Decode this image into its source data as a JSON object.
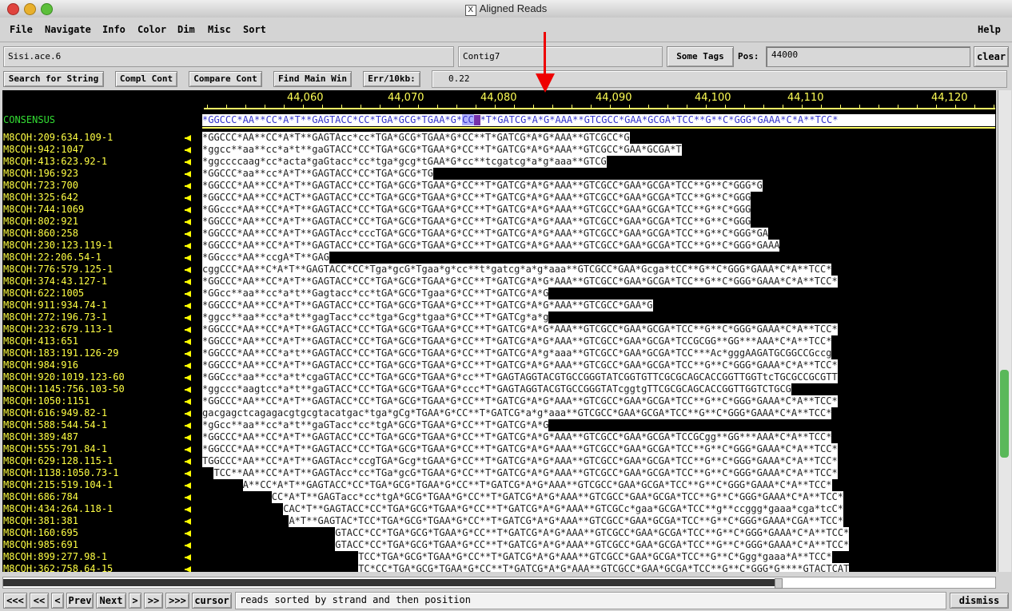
{
  "window": {
    "title": "Aligned Reads",
    "x_icon": "X"
  },
  "menu": [
    "File",
    "Navigate",
    "Info",
    "Color",
    "Dim",
    "Misc",
    "Sort",
    "Help"
  ],
  "info": {
    "file": "Sisi.ace.6",
    "contig": "Contig7",
    "tags_btn": "Some      Tags",
    "pos_label": "Pos:",
    "pos_value": "44000",
    "clear": "clear"
  },
  "toolbar": {
    "search": "Search for String",
    "compl": "Compl Cont",
    "compare": "Compare Cont",
    "find_main": "Find Main Win",
    "err_label": "Err/10kb:",
    "err_value": "0.22"
  },
  "ruler": {
    "labels": [
      "44,060",
      "44,070",
      "44,080",
      "44,090",
      "44,100",
      "44,110",
      "44,120"
    ]
  },
  "consensus": {
    "name": "CONSENSUS",
    "pre": "*GGCCC*AA**CC*A*T**GAGTACC*CC*TGA*GCG*TGAA*G*",
    "hl": "CC",
    "post": "*T*GATCG*A*G*AAA**GTCGCC*GAA*GCGA*TCC**G**C*GGG*GAAA*C*A**TCC*"
  },
  "reads": [
    {
      "name": "M8CQH:209:634.109-1",
      "offset": 0,
      "seq": "*GGCCC*AA**CC*A*T**GAGTAcc*cc*TGA*GCG*TGAA*G*CC**T*GATCG*A*G*AAA**GTCGCC*G"
    },
    {
      "name": "M8CQH:942:1047",
      "offset": 0,
      "seq": "*ggcc**aa**cc*a*t**gaGTACC*CC*TGA*GCG*TGAA*G*CC**T*GATCG*A*G*AAA**GTCGCC*GAA*GCGA*T"
    },
    {
      "name": "M8CQH:413:623.92-1",
      "offset": 0,
      "seq": "*ggccccaag*cc*acta*gaGtacc*cc*tga*gcg*tGAA*G*cc**tcgatcg*a*g*aaa**GTCG"
    },
    {
      "name": "M8CQH:196:923",
      "offset": 0,
      "seq": "*GGCCC*aa**cc*A*T**GAGTACC*CC*TGA*GCG*TG"
    },
    {
      "name": "M8CQH:723:700",
      "offset": 0,
      "seq": "*GGCCC*AA**CC*A*T**GAGTACC*CC*TGA*GCG*TGAA*G*CC**T*GATCG*A*G*AAA**GTCGCC*GAA*GCGA*TCC**G**C*GGG*G"
    },
    {
      "name": "M8CQH:325:642",
      "offset": 0,
      "seq": "*GGCCC*AA**CC*ACT**GAGTACC*CC*TGA*GCG*TGAA*G*CC**T*GATCG*A*G*AAA**GTCGCC*GAA*GCGA*TCC**G**C*GGG"
    },
    {
      "name": "M8CQH:744:1069",
      "offset": 0,
      "seq": "*GGccc*AA**CC*A*T**GAGTACC*CC*TGA*GCG*TGAA*G*CC**T*GATCG*A*G*AAA**GTCGCC*GAA*GCGA*TCC**G**C*GGG"
    },
    {
      "name": "M8CQH:802:921",
      "offset": 0,
      "seq": "*GGCCC*AA**CC*A*T**GAGTACC*CC*TGA*GCG*TGAA*G*CC**T*GATCG*A*G*AAA**GTCGCC*GAA*GCGA*TCC**G**C*GGG"
    },
    {
      "name": "M8CQH:860:258",
      "offset": 0,
      "seq": "*GGCCC*AA**CC*A*T**GAGTAcc*cccTGA*GCG*TGAA*G*CC**T*GATCG*A*G*AAA**GTCGCC*GAA*GCGA*TCC**G**C*GGG*GA"
    },
    {
      "name": "M8CQH:230:123.119-1",
      "offset": 0,
      "seq": "*GGCCC*AA**CC*A*T**GAGTACC*CC*TGA*GCG*TGAA*G*CC**T*GATCG*A*G*AAA**GTCGCC*GAA*GCGA*TCC**G**C*GGG*GAAA"
    },
    {
      "name": "M8CQH:22:206.54-1",
      "offset": 0,
      "seq": "*GGccc*AA**ccgA*T**GAG"
    },
    {
      "name": "M8CQH:776:579.125-1",
      "offset": 0,
      "seq": "cggCCC*AA**C*A*T**GAGTACC*CC*Tga*gcG*Tgaa*g*cc**t*gatcg*a*g*aaa**GTCGCC*GAA*Gcga*tCC**G**C*GGG*GAAA*C*A**TCC*"
    },
    {
      "name": "M8CQH:374:43.127-1",
      "offset": 0,
      "seq": "*GGCCC*AA**CC*A*T**GAGTACC*CC*TGA*GCG*TGAA*G*CC**T*GATCG*A*G*AAA**GTCGCC*GAA*GCGA*TCC**G**C*GGG*GAAA*C*A**TCC*"
    },
    {
      "name": "M8CQH:622:1005",
      "offset": 0,
      "seq": "*GGcc**aa**cc*a*t**Gagtacc*cc*tGA*GCG*Tgaa*G*CC**T*GATCG*A*G"
    },
    {
      "name": "M8CQH:911:934.74-1",
      "offset": 0,
      "seq": "*GGCCC*AA**CC*A*T**GAGTACC*CC*TGA*GCG*TGAA*G*CC**T*GATCG*A*G*AAA**GTCGCC*GAA*G"
    },
    {
      "name": "M8CQH:272:196.73-1",
      "offset": 0,
      "seq": "*ggcc**aa**cc*a*t**gagTacc*cc*tga*Gcg*tgaa*G*CC**T*GATCg*a*g"
    },
    {
      "name": "M8CQH:232:679.113-1",
      "offset": 0,
      "seq": "*GGCCC*AA**CC*A*T**GAGTACC*CC*TGA*GCG*TGAA*G*CC**T*GATCG*A*G*AAA**GTCGCC*GAA*GCGA*TCC**G**C*GGG*GAAA*C*A**TCC*"
    },
    {
      "name": "M8CQH:413:651",
      "offset": 0,
      "seq": "*GGCCC*AA**CC*A*T**GAGTACC*CC*TGA*GCG*TGAA*G*CC**T*GATCG*A*G*AAA**GTCGCC*GAA*GCGA*TCCGCGG**GG***AAA*C*A**TCC*"
    },
    {
      "name": "M8CQH:183:191.126-29",
      "offset": 0,
      "seq": "*GGCCC*AA**CC*a*t**GAGTACC*CC*TGA*GCG*TGAA*G*CC**T*GATCG*A*g*aaa**GTCGCC*GAA*GCGA*TCC***Ac*gggAAGATGCGGCCGccg"
    },
    {
      "name": "M8CQH:984:916",
      "offset": 0,
      "seq": "*GGCCC*AA**CC*A*T**GAGTACC*CC*TGA*GCG*TGAA*G*CC**T*GATCG*A*G*AAA**GTCGCC*GAA*GCGA*TCC**G**C*GGG*GAAA*C*A**TCC*"
    },
    {
      "name": "M8CQH:920:1019.123-60",
      "offset": 0,
      "seq": "*GGCcc*aa**cc*a*t*cgaGTACC*CC*TGA*GCG*TGAA*G*cc**T*GAGTAGGTACGTGCCGGGTATCGGTGTTCGCGCAGCACCGGTTGGTtcTGCGCCGCGTT"
    },
    {
      "name": "M8CQH:1145:756.103-50",
      "offset": 0,
      "seq": "*ggccc*aagtcc*a*t**gaGTACC*CC*TGA*GCG*TGAA*G*ccc*T*GAGTAGGTACGTGCCGGGTATcggtgTTCGCGCAGCACCGGTTGGTCTGCG"
    },
    {
      "name": "M8CQH:1050:1151",
      "offset": 0,
      "seq": "*GGCCC*AA**CC*A*T**GAGTACC*CC*TGA*GCG*TGAA*G*CC**T*GATCG*A*G*AAA**GTCGCC*GAA*GCGA*TCC**G**C*GGG*GAAA*C*A**TCC*"
    },
    {
      "name": "M8CQH:616:949.82-1",
      "offset": 0,
      "seq": "gacgagctcagagacgtgcgtacatgac*tga*gCg*TGAA*G*CC**T*GATCG*a*g*aaa**GTCGCC*GAA*GCGA*TCC**G**C*GGG*GAAA*C*A**TCC*"
    },
    {
      "name": "M8CQH:588:544.54-1",
      "offset": 0,
      "seq": "*gGcc**aa**cc*a*t**gaGTacc*cc*tgA*GCG*TGAA*G*CC**T*GATCG*A*G"
    },
    {
      "name": "M8CQH:389:487",
      "offset": 0,
      "seq": "*GGCCC*AA**CC*A*T**GAGTACC*CC*TGA*GCG*TGAA*G*CC**T*GATCG*A*G*AAA**GTCGCC*GAA*GCGA*TCCGCgg**GG***AAA*C*A**TCC*"
    },
    {
      "name": "M8CQH:555:791.84-1",
      "offset": 0,
      "seq": "*GGCCC*AA**CC*A*T**GAGTACC*CC*TGA*GCG*TGAA*G*CC**T*GATCG*A*G*AAA**GTCGCC*GAA*GCGA*TCC**G**C*GGG*GAAA*C*A**TCC*"
    },
    {
      "name": "M8CQH:629:128.115-1",
      "offset": 0,
      "seq": "TGGCCC*AA**CC*A*T**GAGTAcc*ccgTGA*Gcg*tGAA*G*CC**T*GATCG*A*G*AAA**GTCGCC*GAA*GCGA*TCC**G**C*GGG*GAAA*C*A**TCC*"
    },
    {
      "name": "M8CQH:1138:1050.73-1",
      "offset": 2,
      "seq": "TCC**AA**CC*A*T**GAGTAcc*cc*TGa*gcG*TGAA*G*CC**T*GATCG*A*G*AAA**GTCGCC*GAA*GCGA*TCC**G**C*GGG*GAAA*C*A**TCC*"
    },
    {
      "name": "M8CQH:215:519.104-1",
      "offset": 7,
      "seq": "A**CC*A*T**GAGTACC*CC*TGA*GCG*TGAA*G*CC**T*GATCG*A*G*AAA**GTCGCC*GAA*GCGA*TCC**G**C*GGG*GAAA*C*A**TCC*"
    },
    {
      "name": "M8CQH:686:784",
      "offset": 12,
      "seq": "CC*A*T**GAGTacc*cc*tgA*GCG*TGAA*G*CC**T*GATCG*A*G*AAA**GTCGCC*GAA*GCGA*TCC**G**C*GGG*GAAA*C*A**TCC*"
    },
    {
      "name": "M8CQH:434:264.118-1",
      "offset": 14,
      "seq": "CAC*T**GAGTACC*CC*TGA*GCG*TGAA*G*CC**T*GATCG*A*G*AAA**GTCGCc*gaa*GCGA*TCC**g**ccggg*gaaa*cga*tcC*"
    },
    {
      "name": "M8CQH:381:381",
      "offset": 15,
      "seq": "A*T**GAGTAC*TCC*TGA*GCG*TGAA*G*CC**T*GATCG*A*G*AAA**GTCGCC*GAA*GCGA*TCC**G**C*GGG*GAAA*CGA**TCC*"
    },
    {
      "name": "M8CQH:160:695",
      "offset": 23,
      "seq": "GTACC*CC*TGA*GCG*TGAA*G*CC**T*GATCG*A*G*AAA**GTCGCC*GAA*GCGA*TCC**G**C*GGG*GAAA*C*A**TCC*"
    },
    {
      "name": "M8CQH:985:691",
      "offset": 23,
      "seq": "GTACC*CC*TGA*GCG*TGAA*G*CC**T*GATCG*A*G*AAA**GTCGCC*GAA*GCGA*TCC**G**C*GGG*GAAA*C*A**TCC*"
    },
    {
      "name": "M8CQH:899:277.98-1",
      "offset": 27,
      "seq": "TCC*TGA*GCG*TGAA*G*CC**T*GATCG*A*G*AAA**GTCGCC*GAA*GCGA*TCC**G**C*Ggg*gaaa*A**TCC*"
    },
    {
      "name": "M8CQH:362:758.64-15",
      "offset": 27,
      "seq": "TC*CC*TGA*GCG*TGAA*G*CC**T*GATCG*A*G*AAA**GTCGCC*GAA*GCGA*TCC**G**C*GGG*G****GTACTCAT"
    }
  ],
  "status": {
    "nav": [
      "<<<",
      "<<",
      "<",
      "Prev",
      "Next",
      ">",
      ">>",
      ">>>"
    ],
    "cursor": "cursor",
    "message": "reads sorted by strand and then position",
    "dismiss": "dismiss"
  }
}
